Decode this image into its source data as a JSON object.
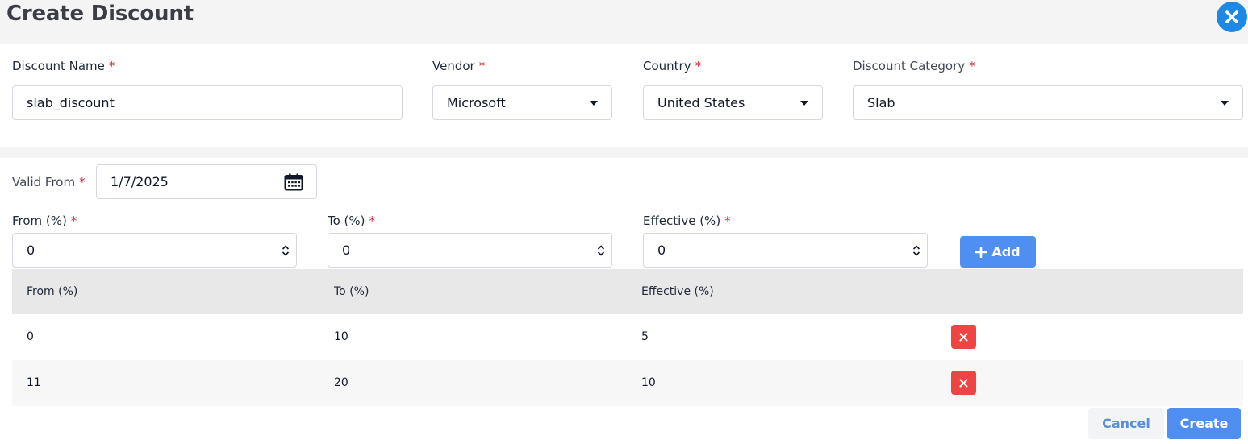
{
  "header": {
    "title": "Create Discount"
  },
  "required_mark": "*",
  "form": {
    "discount_name": {
      "label": "Discount Name",
      "value": "slab_discount"
    },
    "vendor": {
      "label": "Vendor",
      "value": "Microsoft"
    },
    "country": {
      "label": "Country",
      "value": "United States"
    },
    "discount_category": {
      "label": "Discount Category",
      "value": "Slab"
    },
    "valid_from": {
      "label": "Valid From",
      "value": "1/7/2025"
    },
    "from_pct": {
      "label": "From (%)",
      "value": "0"
    },
    "to_pct": {
      "label": "To (%)",
      "value": "0"
    },
    "effective_pct": {
      "label": "Effective (%)",
      "value": "0"
    },
    "add_label": "Add"
  },
  "table": {
    "columns": [
      "From (%)",
      "To (%)",
      "Effective (%)"
    ],
    "rows": [
      {
        "from": "0",
        "to": "10",
        "effective": "5"
      },
      {
        "from": "11",
        "to": "20",
        "effective": "10"
      }
    ]
  },
  "footer": {
    "cancel_label": "Cancel",
    "create_label": "Create"
  },
  "colors": {
    "primary": "#4e8ff1",
    "close": "#1e88e5",
    "danger": "#ef4444",
    "required": "#e11d2e"
  }
}
